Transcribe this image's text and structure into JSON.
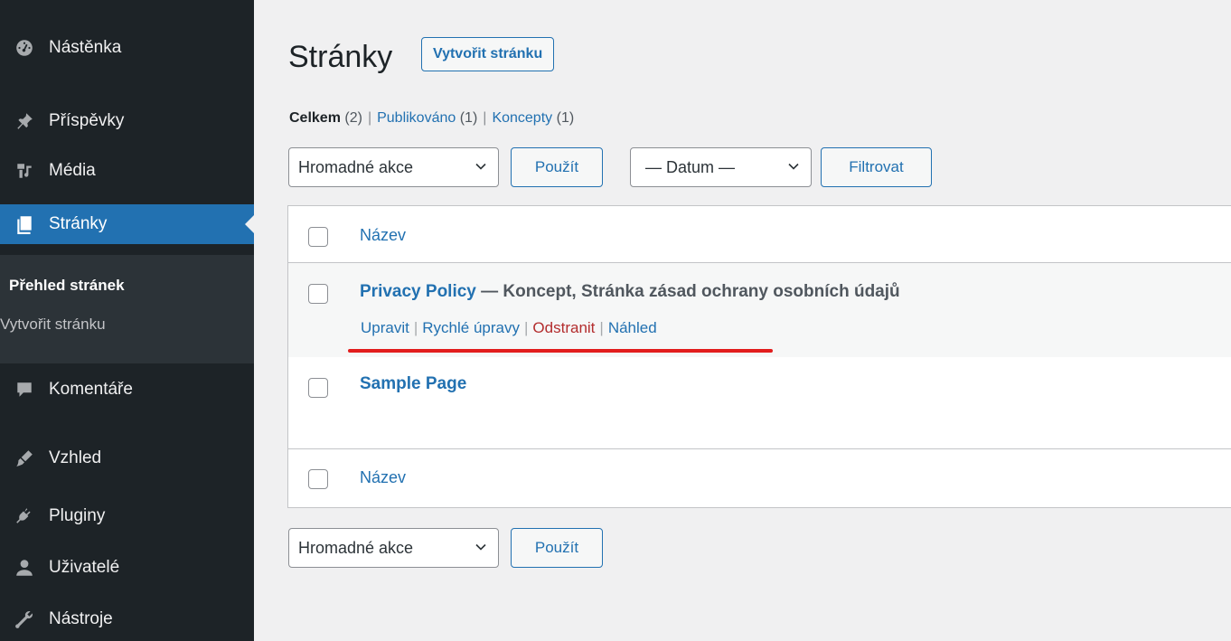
{
  "sidebar": {
    "items": [
      {
        "label": "Nástěnka",
        "icon": "dashboard-icon"
      },
      {
        "label": "Příspěvky",
        "icon": "pin-icon"
      },
      {
        "label": "Média",
        "icon": "media-icon"
      },
      {
        "label": "Stránky",
        "icon": "page-icon",
        "active": true
      },
      {
        "label": "Komentáře",
        "icon": "comment-icon"
      },
      {
        "label": "Vzhled",
        "icon": "brush-icon"
      },
      {
        "label": "Pluginy",
        "icon": "plugin-icon"
      },
      {
        "label": "Uživatelé",
        "icon": "user-icon"
      },
      {
        "label": "Nástroje",
        "icon": "wrench-icon"
      }
    ],
    "submenu": [
      {
        "label": "Přehled stránek",
        "current": true
      },
      {
        "label": "Vytvořit stránku"
      }
    ]
  },
  "header": {
    "title": "Stránky",
    "add_new": "Vytvořit stránku"
  },
  "filters": {
    "all_label": "Celkem",
    "all_count": "(2)",
    "published_label": "Publikováno",
    "published_count": "(1)",
    "drafts_label": "Koncepty",
    "drafts_count": "(1)",
    "separator": "|"
  },
  "tablenav_top": {
    "bulk_actions": "Hromadné akce",
    "apply": "Použít",
    "date": "— Datum —",
    "filter": "Filtrovat"
  },
  "table": {
    "column_title": "Název",
    "rows": [
      {
        "title": "Privacy Policy",
        "state": " — Koncept, Stránka zásad ochrany osobních údajů",
        "actions": [
          "Upravit",
          "Rychlé úpravy",
          "Odstranit",
          "Náhled"
        ]
      },
      {
        "title": "Sample Page"
      }
    ]
  },
  "tablenav_bottom": {
    "bulk_actions": "Hromadné akce",
    "apply": "Použít"
  },
  "colors": {
    "accent": "#2271b1",
    "sidebar_bg": "#1d2327",
    "delete": "#b32d2e",
    "annotation": "#e21d1d"
  }
}
